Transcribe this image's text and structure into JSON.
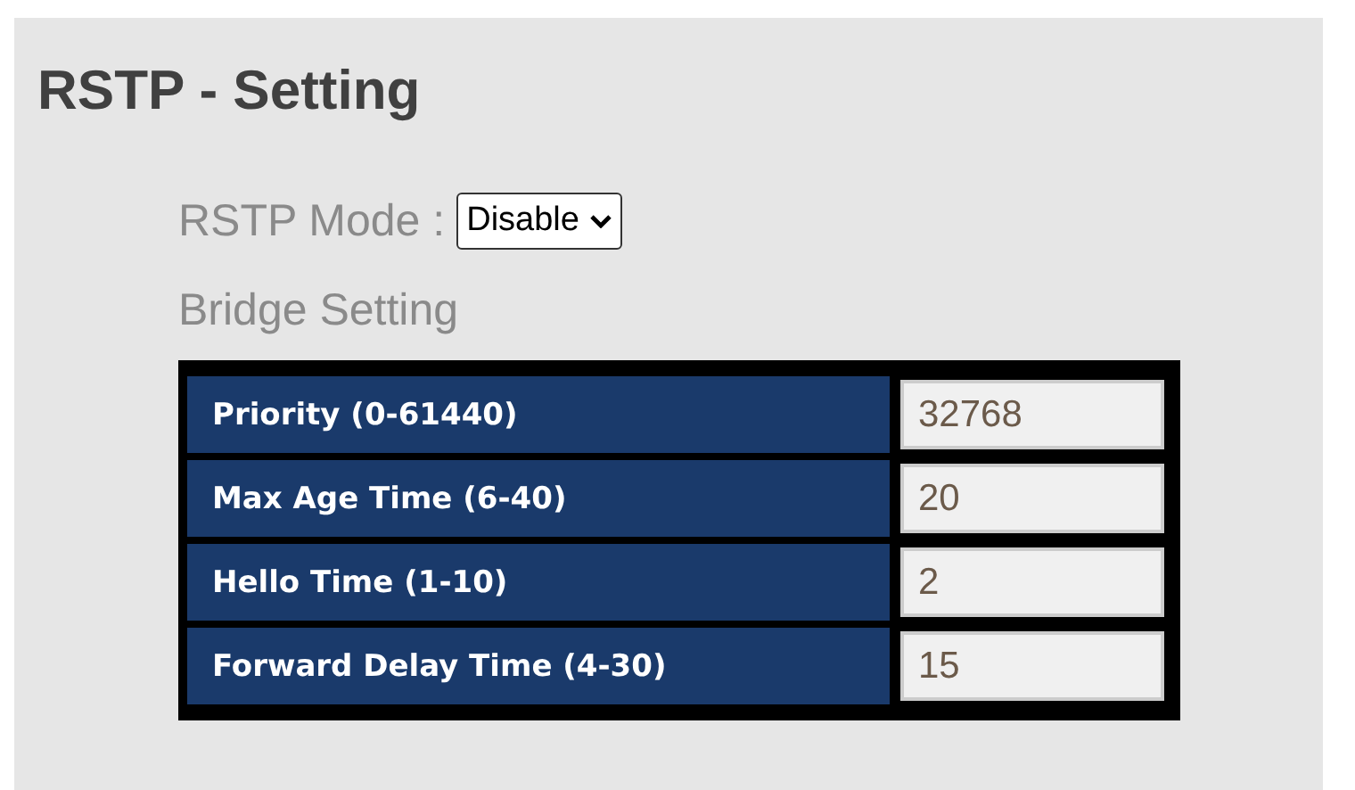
{
  "title": "RSTP - Setting",
  "mode": {
    "label": "RSTP Mode :",
    "value": "Disable"
  },
  "section": "Bridge Setting",
  "rows": [
    {
      "label": "Priority (0-61440)",
      "value": "32768"
    },
    {
      "label": "Max Age Time (6-40)",
      "value": "20"
    },
    {
      "label": "Hello Time (1-10)",
      "value": "2"
    },
    {
      "label": "Forward Delay Time (4-30)",
      "value": "15"
    }
  ]
}
